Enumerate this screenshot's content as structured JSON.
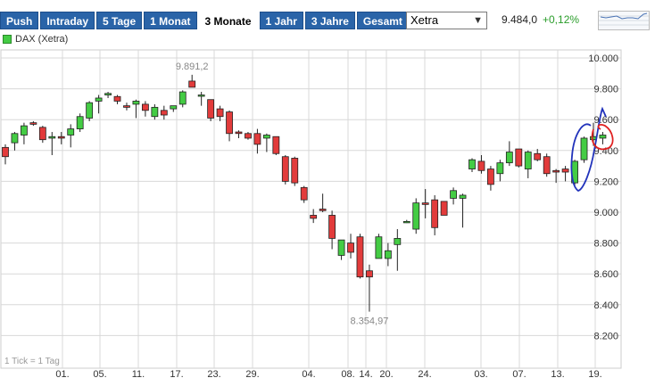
{
  "tabs": [
    {
      "label": "Push",
      "active": false
    },
    {
      "label": "Intraday",
      "active": false
    },
    {
      "label": "5 Tage",
      "active": false
    },
    {
      "label": "1 Monat",
      "active": false
    },
    {
      "label": "3 Monate",
      "active": true
    },
    {
      "label": "1 Jahr",
      "active": false
    },
    {
      "label": "3 Jahre",
      "active": false
    },
    {
      "label": "Gesamt",
      "active": false
    }
  ],
  "exchange_select": {
    "value": "Xetra"
  },
  "quote": {
    "price": "9.484,0",
    "change": "+0,12%"
  },
  "legend": {
    "label": "DAX (Xetra)"
  },
  "footer": {
    "interval": "1 Tick = 1 Tag"
  },
  "colors": {
    "up": "#44cc44",
    "down": "#e23b3b",
    "grid": "#d8d8d8",
    "tab": "#2a64a8",
    "annotation_blue": "#2233bb",
    "annotation_red": "#e02020"
  },
  "chart_data": {
    "type": "candlestick",
    "x_tick_labels": [
      "01.",
      "05.",
      "11.",
      "17.",
      "23.",
      "29.",
      "04.",
      "08.",
      "14.",
      "20.",
      "24.",
      "03.",
      "07.",
      "13.",
      "19."
    ],
    "y_tick_labels": [
      "10.000",
      "9.800",
      "9.600",
      "9.400",
      "9.200",
      "9.000",
      "8.800",
      "8.600",
      "8.400",
      "8.200"
    ],
    "ylim": [
      8100,
      10050
    ],
    "annotations": {
      "high": "9.891,2",
      "low": "8.354,97"
    },
    "candles": [
      [
        9420,
        9440,
        9310,
        9360
      ],
      [
        9450,
        9520,
        9400,
        9510
      ],
      [
        9500,
        9580,
        9440,
        9560
      ],
      [
        9580,
        9590,
        9560,
        9570
      ],
      [
        9550,
        9560,
        9450,
        9470
      ],
      [
        9480,
        9520,
        9370,
        9490
      ],
      [
        9490,
        9520,
        9440,
        9480
      ],
      [
        9500,
        9570,
        9420,
        9540
      ],
      [
        9540,
        9640,
        9520,
        9620
      ],
      [
        9610,
        9720,
        9590,
        9710
      ],
      [
        9720,
        9760,
        9640,
        9740
      ],
      [
        9760,
        9780,
        9740,
        9770
      ],
      [
        9750,
        9760,
        9700,
        9720
      ],
      [
        9690,
        9710,
        9660,
        9680
      ],
      [
        9700,
        9730,
        9610,
        9720
      ],
      [
        9700,
        9720,
        9620,
        9660
      ],
      [
        9620,
        9700,
        9600,
        9680
      ],
      [
        9660,
        9690,
        9600,
        9630
      ],
      [
        9670,
        9690,
        9650,
        9690
      ],
      [
        9700,
        9790,
        9680,
        9780
      ],
      [
        9850,
        9891,
        9810,
        9810
      ],
      [
        9760,
        9780,
        9690,
        9760
      ],
      [
        9730,
        9730,
        9590,
        9610
      ],
      [
        9670,
        9690,
        9590,
        9620
      ],
      [
        9650,
        9660,
        9460,
        9510
      ],
      [
        9520,
        9530,
        9480,
        9510
      ],
      [
        9510,
        9520,
        9470,
        9480
      ],
      [
        9510,
        9540,
        9380,
        9440
      ],
      [
        9480,
        9510,
        9390,
        9500
      ],
      [
        9490,
        9480,
        9370,
        9380
      ],
      [
        9360,
        9370,
        9180,
        9200
      ],
      [
        9350,
        9360,
        9170,
        9190
      ],
      [
        9160,
        9170,
        9060,
        9080
      ],
      [
        8980,
        9020,
        8930,
        8960
      ],
      [
        9020,
        9120,
        9000,
        9010
      ],
      [
        8980,
        9010,
        8760,
        8830
      ],
      [
        8720,
        8820,
        8690,
        8820
      ],
      [
        8800,
        8860,
        8700,
        8740
      ],
      [
        8840,
        8860,
        8570,
        8580
      ],
      [
        8620,
        8660,
        8355,
        8580
      ],
      [
        8700,
        8860,
        8700,
        8840
      ],
      [
        8700,
        8800,
        8650,
        8750
      ],
      [
        8790,
        8890,
        8620,
        8830
      ],
      [
        8940,
        8950,
        8930,
        8940
      ],
      [
        8890,
        9090,
        8860,
        9060
      ],
      [
        9060,
        9150,
        8960,
        9050
      ],
      [
        9080,
        9110,
        8850,
        8900
      ],
      [
        9070,
        9070,
        8980,
        8980
      ],
      [
        9090,
        9160,
        9050,
        9140
      ],
      [
        9090,
        9120,
        8900,
        9110
      ],
      [
        9280,
        9350,
        9260,
        9340
      ],
      [
        9330,
        9370,
        9250,
        9270
      ],
      [
        9280,
        9300,
        9140,
        9180
      ],
      [
        9250,
        9340,
        9200,
        9320
      ],
      [
        9320,
        9460,
        9300,
        9390
      ],
      [
        9410,
        9410,
        9290,
        9300
      ],
      [
        9280,
        9400,
        9220,
        9390
      ],
      [
        9380,
        9410,
        9330,
        9340
      ],
      [
        9360,
        9380,
        9230,
        9250
      ],
      [
        9270,
        9280,
        9190,
        9260
      ],
      [
        9280,
        9300,
        9200,
        9260
      ],
      [
        9190,
        9340,
        9160,
        9330
      ],
      [
        9340,
        9490,
        9320,
        9480
      ],
      [
        9470,
        9580,
        9430,
        9490
      ],
      [
        9480,
        9520,
        9440,
        9500
      ]
    ]
  }
}
